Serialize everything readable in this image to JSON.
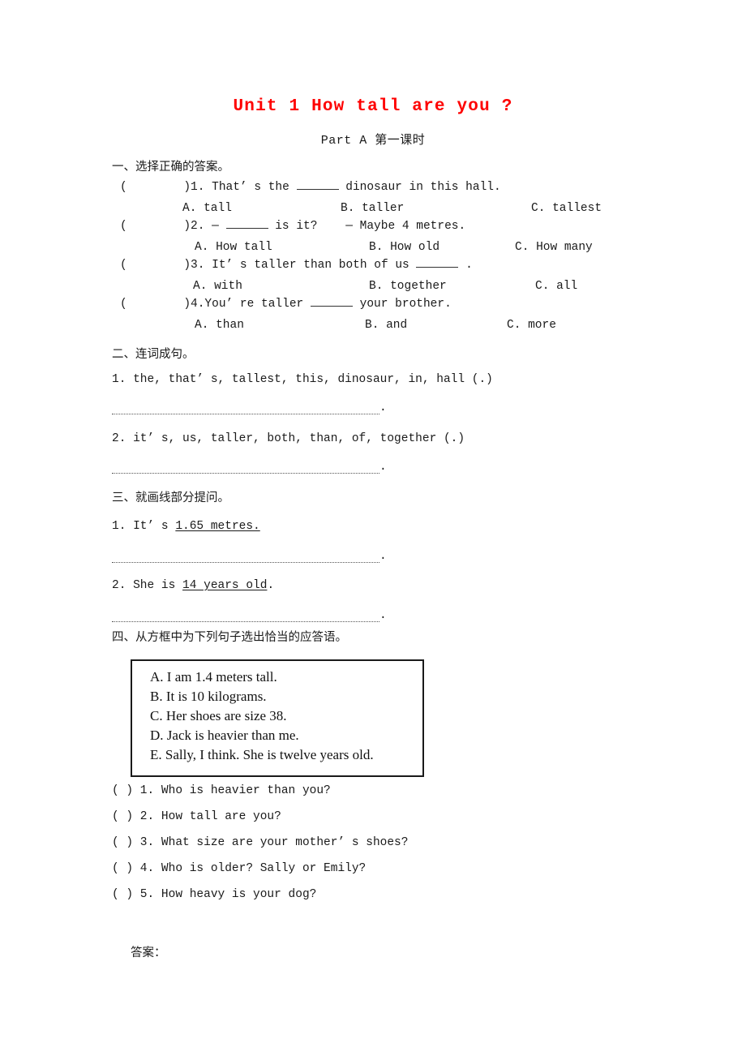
{
  "document": {
    "title": "Unit 1 How tall are you ?",
    "subtitle": "Part A 第一课时",
    "title_color": "#fe0000",
    "footer_answer_label": "答案："
  },
  "section_one": {
    "heading": "一、选择正确的答案。",
    "questions": [
      {
        "bracket": "(        )",
        "number": "1.",
        "stem_before": " That’ s the ",
        "stem_after": " dinosaur in this hall.",
        "options": [
          "A. tall",
          "B. taller",
          "C. tallest"
        ]
      },
      {
        "bracket": "(        )",
        "number": "2.",
        "stem_before": " — ",
        "stem_after": " is it?    — Maybe 4 metres.",
        "options": [
          "A. How tall",
          "B. How old",
          "C. How many"
        ]
      },
      {
        "bracket": "(        )",
        "number": "3.",
        "stem_before": " It’ s taller than both of us ",
        "stem_after": " .",
        "options": [
          "A. with",
          "B. together",
          "C. all"
        ]
      },
      {
        "bracket": "(        )",
        "number": "4.",
        "stem_before": "You’ re taller ",
        "stem_after": " your brother.",
        "options": [
          "A. than",
          "B. and",
          "C. more"
        ]
      }
    ]
  },
  "section_two": {
    "heading": "二、连词成句。",
    "items": [
      "1. the, that’ s, tallest, this, dinosaur, in, hall (.)",
      "2. it’ s, us, taller, both, than, of, together (.)"
    ],
    "answer_line_end": "."
  },
  "section_three": {
    "heading": "三、就画线部分提问。",
    "items": [
      {
        "prefix": "1. It’ s ",
        "underlined": "1.65 metres.",
        "suffix": ""
      },
      {
        "prefix": "2. She is ",
        "underlined": "14 years old",
        "suffix": "."
      }
    ],
    "answer_line_end": "."
  },
  "section_four": {
    "heading": "四、从方框中为下列句子选出恰当的应答语。",
    "box_options": [
      "A. I am 1.4 meters tall.",
      "B. It is 10 kilograms.",
      "C. Her shoes are size 38.",
      "D. Jack is heavier than me.",
      "E. Sally, I think. She is twelve years old."
    ],
    "questions": [
      "( ) 1. Who is heavier than you?",
      "( ) 2. How tall are you?",
      "( ) 3. What size are your mother’ s shoes?",
      "( ) 4. Who is older? Sally or Emily?",
      "( ) 5. How heavy is your dog?"
    ]
  }
}
